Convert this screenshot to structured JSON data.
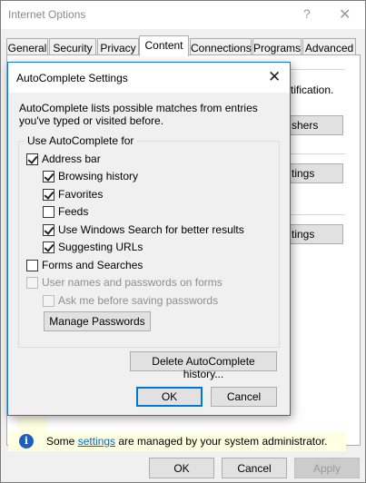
{
  "window": {
    "title": "Internet Options",
    "help_glyph": "?",
    "close_glyph": "✕"
  },
  "tabs": [
    {
      "label": "General"
    },
    {
      "label": "Security"
    },
    {
      "label": "Privacy"
    },
    {
      "label": "Content",
      "active": true
    },
    {
      "label": "Connections"
    },
    {
      "label": "Programs"
    },
    {
      "label": "Advanced"
    }
  ],
  "background": {
    "partial_text": "tification.",
    "btn_publishers": "shers",
    "btn_settings_1": "tings",
    "btn_settings_2": "tings"
  },
  "info_bar": {
    "prefix": "Some ",
    "link": "settings",
    "suffix": " are managed by your system administrator."
  },
  "bottom_buttons": {
    "ok": "OK",
    "cancel": "Cancel",
    "apply": "Apply"
  },
  "dialog": {
    "title": "AutoComplete Settings",
    "close_glyph": "✕",
    "description": "AutoComplete lists possible matches from entries you've typed or visited before.",
    "group_label": "Use AutoComplete for",
    "options": {
      "address_bar": {
        "label": "Address bar",
        "checked": true
      },
      "browsing_history": {
        "label": "Browsing history",
        "checked": true
      },
      "favorites": {
        "label": "Favorites",
        "checked": true
      },
      "feeds": {
        "label": "Feeds",
        "checked": false
      },
      "windows_search": {
        "label": "Use Windows Search for better results",
        "checked": true
      },
      "suggesting_urls": {
        "label": "Suggesting URLs",
        "checked": true
      },
      "forms_searches": {
        "label": "Forms and Searches",
        "checked": false
      },
      "user_names_passwords": {
        "label": "User names and passwords on forms",
        "checked": false
      },
      "ask_before_saving": {
        "label": "Ask me before saving passwords",
        "checked": false
      }
    },
    "manage_passwords": "Manage Passwords",
    "delete_history": "Delete AutoComplete history...",
    "ok": "OK",
    "cancel": "Cancel"
  }
}
